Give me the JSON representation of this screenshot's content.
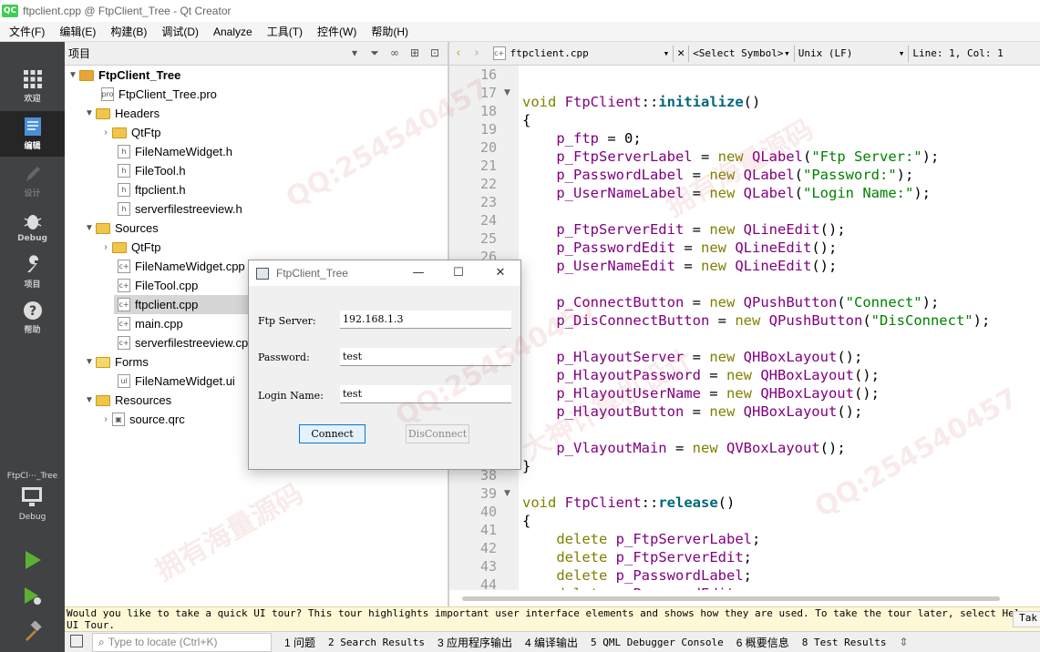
{
  "window": {
    "logo": "QC",
    "title": "ftpclient.cpp @ FtpClient_Tree - Qt Creator"
  },
  "menu": [
    "文件(F)",
    "编辑(E)",
    "构建(B)",
    "调试(D)",
    "Analyze",
    "工具(T)",
    "控件(W)",
    "帮助(H)"
  ],
  "modes": {
    "welcome": "欢迎",
    "edit": "编辑",
    "design": "设计",
    "debug": "Debug",
    "projects": "项目",
    "help": "帮助"
  },
  "kit": {
    "project": "FtpCl⋯_Tree",
    "mode": "Debug"
  },
  "project_panel": {
    "title": "项目",
    "tree": [
      {
        "label": "FtpClient_Tree",
        "bold": true
      },
      {
        "label": "FtpClient_Tree.pro"
      },
      {
        "label": "Headers"
      },
      {
        "label": "QtFtp"
      },
      {
        "label": "FileNameWidget.h"
      },
      {
        "label": "FileTool.h"
      },
      {
        "label": "ftpclient.h"
      },
      {
        "label": "serverfilestreeview.h"
      },
      {
        "label": "Sources"
      },
      {
        "label": "QtFtp"
      },
      {
        "label": "FileNameWidget.cpp"
      },
      {
        "label": "FileTool.cpp"
      },
      {
        "label": "ftpclient.cpp"
      },
      {
        "label": "main.cpp"
      },
      {
        "label": "serverfilestreeview.cp"
      },
      {
        "label": "Forms"
      },
      {
        "label": "FileNameWidget.ui"
      },
      {
        "label": "Resources"
      },
      {
        "label": "source.qrc"
      }
    ]
  },
  "editor_toolbar": {
    "file": "ftpclient.cpp",
    "symbol": "<Select Symbol>",
    "line_ending": "Unix (LF)",
    "position": "Line: 1, Col: 1"
  },
  "editor": {
    "line_numbers": [
      "16",
      "17",
      "18",
      "19",
      "20",
      "21",
      "22",
      "23",
      "24",
      "25",
      "26",
      "27",
      "28",
      "29",
      "30",
      "31",
      "32",
      "33",
      "34",
      "35",
      "36",
      "37",
      "38",
      "39",
      "40",
      "41",
      "42",
      "43",
      "44"
    ]
  },
  "info_bar": {
    "message": "Would you like to take a quick UI tour? This tour highlights important user interface elements and shows how they are used. To take the tour later, select Help > UI Tour.",
    "button": "Tak"
  },
  "status_bar": {
    "locator_placeholder": "Type to locate (Ctrl+K)",
    "panes": [
      "1 问题",
      "2 Search Results",
      "3 应用程序输出",
      "4 编译输出",
      "5 QML Debugger Console",
      "6 概要信息",
      "8 Test Results"
    ]
  },
  "dialog": {
    "title": "FtpClient_Tree",
    "ftp_server_label": "Ftp Server:",
    "ftp_server_value": "192.168.1.3",
    "password_label": "Password:",
    "password_value": "test",
    "login_label": "Login Name:",
    "login_value": "test",
    "connect": "Connect",
    "disconnect": "DisConnect"
  },
  "watermarks": [
    "QQ:254540457",
    "拥有海量源码",
    "大神计算机设计"
  ]
}
